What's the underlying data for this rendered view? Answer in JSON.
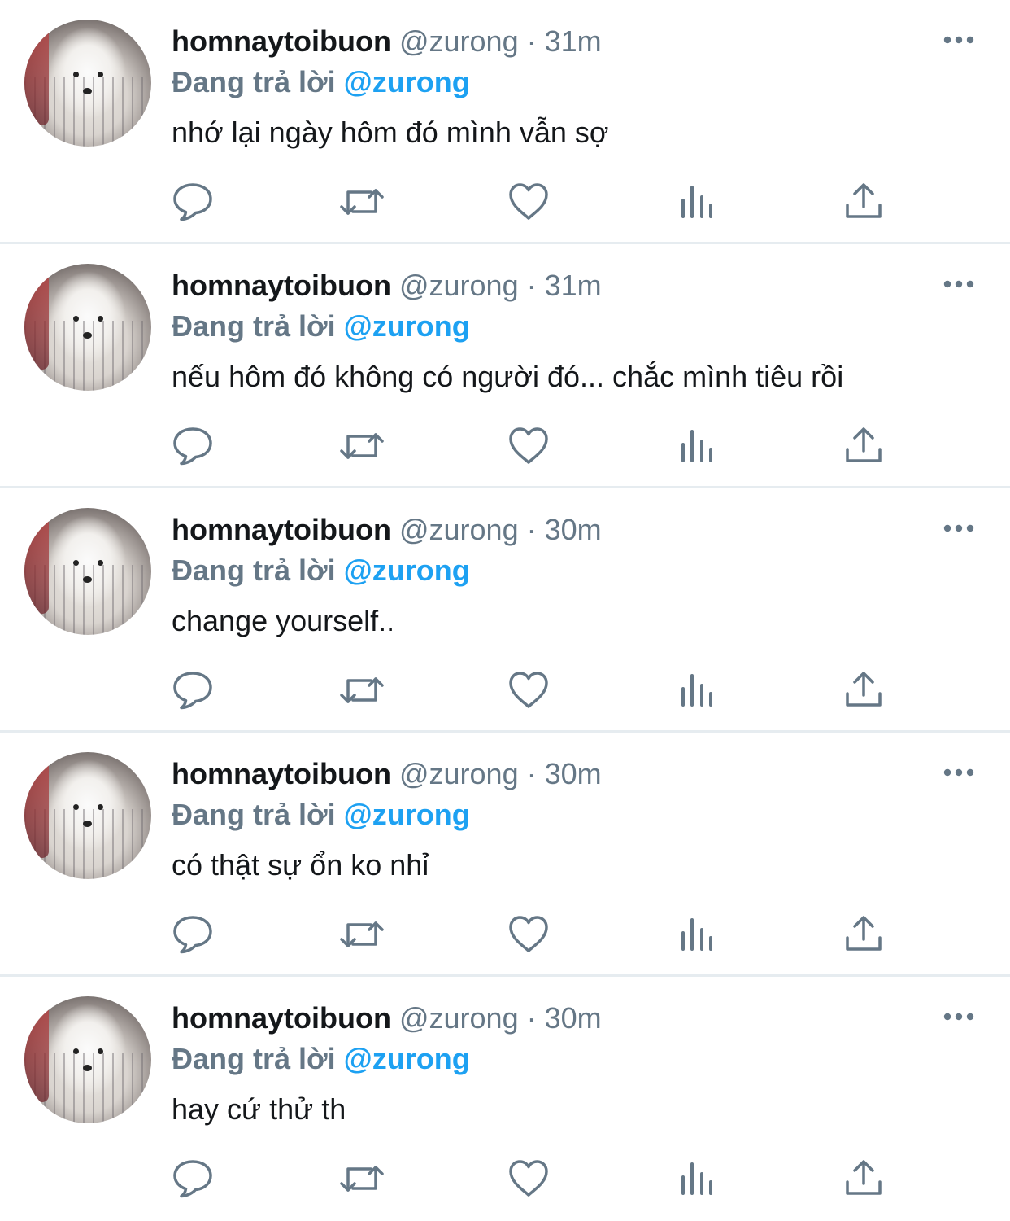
{
  "tweets": [
    {
      "display_name": "homnaytoibuon",
      "handle": "@zurong",
      "separator": "·",
      "time": "31m",
      "reply_label": "Đang trả lời",
      "reply_to": "@zurong",
      "text": "nhớ lại ngày hôm đó mình vẫn sợ"
    },
    {
      "display_name": "homnaytoibuon",
      "handle": "@zurong",
      "separator": "·",
      "time": "31m",
      "reply_label": "Đang trả lời",
      "reply_to": "@zurong",
      "text": "nếu hôm đó không có người đó... chắc mình tiêu rồi"
    },
    {
      "display_name": "homnaytoibuon",
      "handle": "@zurong",
      "separator": "·",
      "time": "30m",
      "reply_label": "Đang trả lời",
      "reply_to": "@zurong",
      "text": "change yourself.."
    },
    {
      "display_name": "homnaytoibuon",
      "handle": "@zurong",
      "separator": "·",
      "time": "30m",
      "reply_label": "Đang trả lời",
      "reply_to": "@zurong",
      "text": "có thật sự ổn ko nhỉ"
    },
    {
      "display_name": "homnaytoibuon",
      "handle": "@zurong",
      "separator": "·",
      "time": "30m",
      "reply_label": "Đang trả lời",
      "reply_to": "@zurong",
      "text": "hay cứ thử th"
    }
  ],
  "icons": {
    "avatar": "samoyed-dog-photo",
    "more": "more-horizontal-icon",
    "reply": "reply-bubble-icon",
    "retweet": "retweet-icon",
    "like": "heart-icon",
    "views": "bar-chart-icon",
    "share": "share-upload-icon"
  },
  "colors": {
    "text_primary": "#14171a",
    "text_secondary": "#657786",
    "mention": "#1da1f2",
    "divider": "#e6ecf0"
  }
}
